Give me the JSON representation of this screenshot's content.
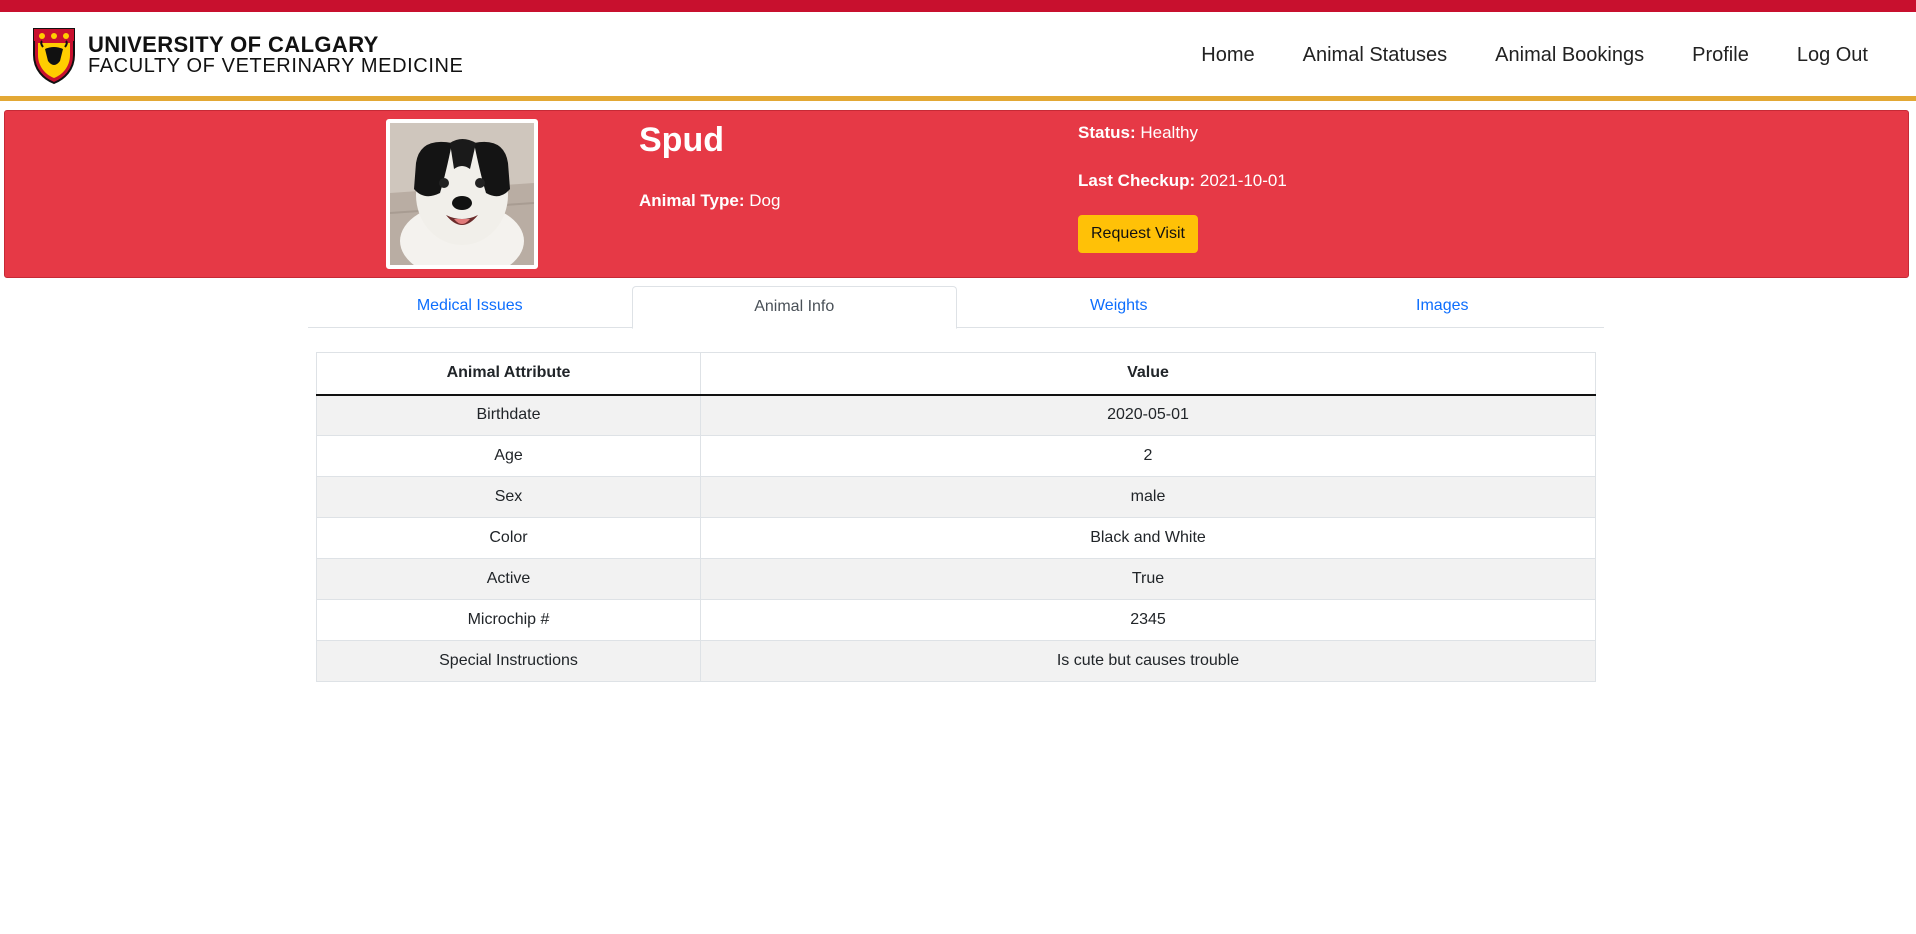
{
  "brand": {
    "line1": "UNIVERSITY OF CALGARY",
    "line2": "FACULTY OF VETERINARY MEDICINE"
  },
  "nav": {
    "items": [
      {
        "label": "Home"
      },
      {
        "label": "Animal Statuses"
      },
      {
        "label": "Animal Bookings"
      },
      {
        "label": "Profile"
      },
      {
        "label": "Log Out"
      }
    ]
  },
  "animal": {
    "name": "Spud",
    "type_label": "Animal Type:",
    "type_value": "Dog",
    "status_label": "Status:",
    "status_value": "Healthy",
    "checkup_label": "Last Checkup:",
    "checkup_value": "2021-10-01",
    "request_button": "Request Visit"
  },
  "tabs": [
    {
      "label": "Medical Issues",
      "active": false
    },
    {
      "label": "Animal Info",
      "active": true
    },
    {
      "label": "Weights",
      "active": false
    },
    {
      "label": "Images",
      "active": false
    }
  ],
  "table": {
    "headers": [
      "Animal Attribute",
      "Value"
    ],
    "rows": [
      {
        "attribute": "Birthdate",
        "value": "2020-05-01"
      },
      {
        "attribute": "Age",
        "value": "2"
      },
      {
        "attribute": "Sex",
        "value": "male"
      },
      {
        "attribute": "Color",
        "value": "Black and White"
      },
      {
        "attribute": "Active",
        "value": "True"
      },
      {
        "attribute": "Microchip #",
        "value": "2345"
      },
      {
        "attribute": "Special Instructions",
        "value": "Is cute but causes trouble"
      }
    ]
  },
  "colors": {
    "top_stripe": "#c8102e",
    "nav_underline": "#e3a835",
    "hero_background": "#e63946",
    "button": "#ffc107",
    "tab_link": "#0d6efd"
  }
}
